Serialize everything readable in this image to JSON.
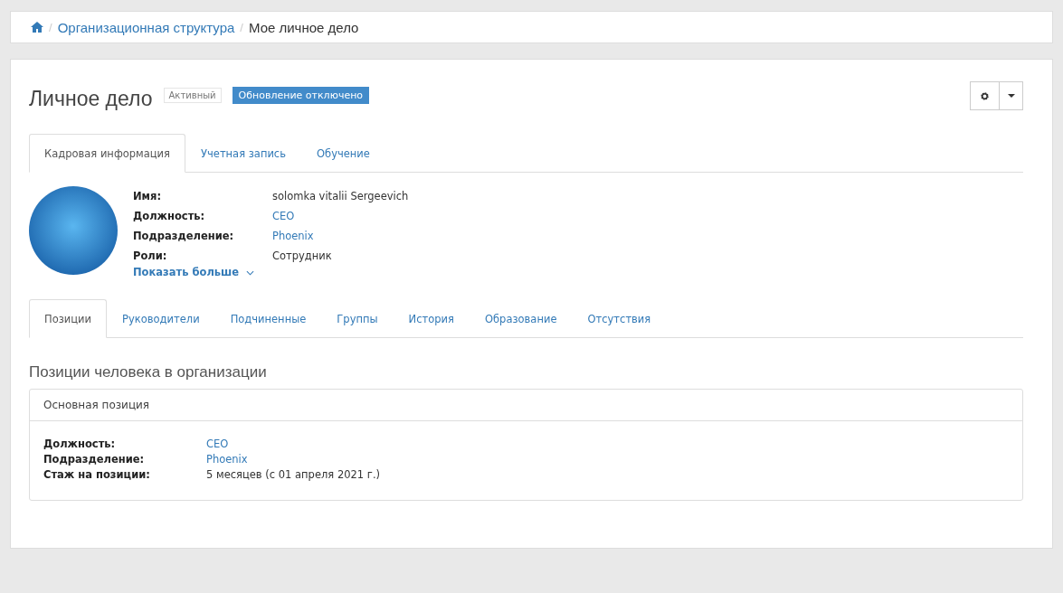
{
  "breadcrumb": {
    "separator": "/",
    "items": [
      {
        "label": "Организационная структура",
        "kind": "link"
      },
      {
        "label": "Мое личное дело",
        "kind": "current"
      }
    ]
  },
  "header": {
    "title": "Личное дело",
    "status_badge": "Активный",
    "update_badge": "Обновление отключено"
  },
  "tabs": [
    {
      "label": "Кадровая информация",
      "selected": true
    },
    {
      "label": "Учетная запись",
      "selected": false
    },
    {
      "label": "Обучение",
      "selected": false
    }
  ],
  "profile": {
    "fields": [
      {
        "label": "Имя:",
        "value": "solomka vitalii Sergeevich",
        "kind": "text"
      },
      {
        "label": "Должность:",
        "value": "CEO",
        "kind": "link"
      },
      {
        "label": "Подразделение:",
        "value": "Phoenix",
        "kind": "link"
      },
      {
        "label": "Роли:",
        "value": "Сотрудник",
        "kind": "text"
      }
    ],
    "show_more": "Показать больше"
  },
  "subtabs": [
    {
      "label": "Позиции",
      "selected": true
    },
    {
      "label": "Руководители",
      "selected": false
    },
    {
      "label": "Подчиненные",
      "selected": false
    },
    {
      "label": "Группы",
      "selected": false
    },
    {
      "label": "История",
      "selected": false
    },
    {
      "label": "Образование",
      "selected": false
    },
    {
      "label": "Отсутствия",
      "selected": false
    }
  ],
  "section_title": "Позиции человека в организации",
  "position_panel": {
    "title": "Основная позиция",
    "fields": [
      {
        "label": "Должность:",
        "value": "CEO",
        "kind": "link"
      },
      {
        "label": "Подразделение:",
        "value": "Phoenix",
        "kind": "link"
      },
      {
        "label": "Стаж на позиции:",
        "value": "5 месяцев (с 01 апреля 2021 г.)",
        "kind": "text"
      }
    ]
  }
}
